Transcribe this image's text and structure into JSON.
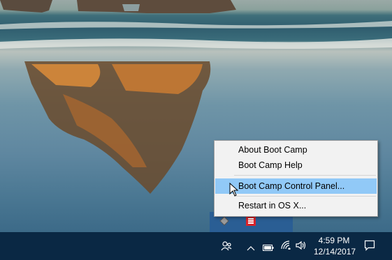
{
  "context_menu": {
    "items": [
      {
        "label": "About Boot Camp"
      },
      {
        "label": "Boot Camp Help"
      },
      {
        "label": "Boot Camp Control Panel..."
      },
      {
        "label": "Restart in OS X..."
      }
    ],
    "highlighted_index": 2
  },
  "tray_flyout": {
    "icons": [
      "boot-camp-diamond-icon",
      "red-app-icon"
    ]
  },
  "taskbar": {
    "icons": [
      "people-icon",
      "chevron-up-icon",
      "battery-icon",
      "wifi-icon",
      "volume-icon",
      "action-center-icon"
    ],
    "clock": {
      "time": "4:59 PM",
      "date": "12/14/2017"
    }
  },
  "colors": {
    "taskbar": "#0a2844",
    "flyout": "#2a5e94",
    "menu_bg": "#f2f2f2",
    "menu_highlight": "#91c9f7"
  }
}
